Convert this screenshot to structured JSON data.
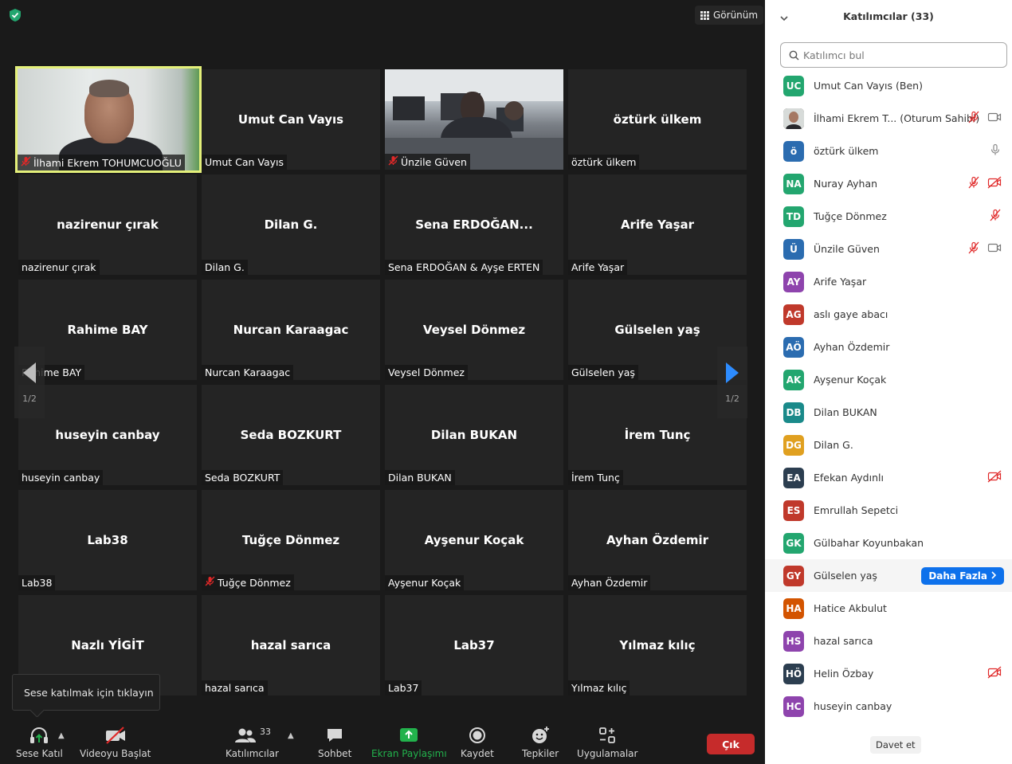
{
  "toolbar_top": {
    "view_label": "Görünüm"
  },
  "tiles": [
    {
      "center": "",
      "label": "İlhami Ekrem TOHUMCUOĞLU",
      "muted": true,
      "video": "ilhami",
      "active": true
    },
    {
      "center": "Umut Can Vayıs",
      "label": "Umut Can Vayıs",
      "muted": false
    },
    {
      "center": "",
      "label": "Ünzile Güven",
      "muted": true,
      "video": "classroom"
    },
    {
      "center": "öztürk ülkem",
      "label": "öztürk ülkem",
      "muted": false
    },
    {
      "center": "nazirenur çırak",
      "label": "nazirenur çırak",
      "muted": false
    },
    {
      "center": "Dilan G.",
      "label": "Dilan G.",
      "muted": false
    },
    {
      "center": "Sena ERDOĞAN...",
      "label": "Sena ERDOĞAN & Ayşe ERTEN",
      "muted": false
    },
    {
      "center": "Arife Yaşar",
      "label": "Arife Yaşar",
      "muted": false
    },
    {
      "center": "Rahime BAY",
      "label": "Rahime BAY",
      "muted": false
    },
    {
      "center": "Nurcan Karaagac",
      "label": "Nurcan Karaagac",
      "muted": false
    },
    {
      "center": "Veysel Dönmez",
      "label": "Veysel Dönmez",
      "muted": false
    },
    {
      "center": "Gülselen yaş",
      "label": "Gülselen yaş",
      "muted": false
    },
    {
      "center": "huseyin canbay",
      "label": "huseyin canbay",
      "muted": false
    },
    {
      "center": "Seda BOZKURT",
      "label": "Seda BOZKURT",
      "muted": false
    },
    {
      "center": "Dilan BUKAN",
      "label": "Dilan BUKAN",
      "muted": false
    },
    {
      "center": "İrem Tunç",
      "label": "İrem Tunç",
      "muted": false
    },
    {
      "center": "Lab38",
      "label": "Lab38",
      "muted": false
    },
    {
      "center": "Tuğçe Dönmez",
      "label": "Tuğçe Dönmez",
      "muted": true
    },
    {
      "center": "Ayşenur Koçak",
      "label": "Ayşenur Koçak",
      "muted": false
    },
    {
      "center": "Ayhan Özdemir",
      "label": "Ayhan Özdemir",
      "muted": false
    },
    {
      "center": "Nazlı YİGİT",
      "label": "",
      "muted": false
    },
    {
      "center": "hazal sarıca",
      "label": "hazal sarıca",
      "muted": false
    },
    {
      "center": "Lab37",
      "label": "Lab37",
      "muted": false
    },
    {
      "center": "Yılmaz kılıç",
      "label": "Yılmaz kılıç",
      "muted": false
    }
  ],
  "pager": {
    "left": "1/2",
    "right": "1/2"
  },
  "tooltip": "Sese katılmak için tıklayın",
  "toolbar": {
    "join_audio": "Sese Katıl",
    "start_video": "Videoyu Başlat",
    "participants": "Katılımcılar",
    "participants_count": "33",
    "chat": "Sohbet",
    "share": "Ekran Paylaşımı",
    "record": "Kaydet",
    "reactions": "Tepkiler",
    "apps": "Uygulamalar",
    "leave": "Çık"
  },
  "panel": {
    "title": "Katılımcılar (33)",
    "search_placeholder": "Katılımcı bul",
    "more_label": "Daha Fazla",
    "invite_label": "Davet et",
    "participants": [
      {
        "initials": "UC",
        "color": "#23a66f",
        "name": "Umut Can Vayıs (Ben)",
        "icons": []
      },
      {
        "initials": "",
        "color": "#5a4a42",
        "name": "İlhami Ekrem T...  (Oturum Sahibi)",
        "icons": [
          "mic-muted",
          "video"
        ],
        "photo": true
      },
      {
        "initials": "ö",
        "color": "#2b6cb0",
        "name": "öztürk ülkem",
        "icons": [
          "mic-gray"
        ]
      },
      {
        "initials": "NA",
        "color": "#23a66f",
        "name": "Nuray Ayhan",
        "icons": [
          "mic-muted",
          "video-off"
        ]
      },
      {
        "initials": "TD",
        "color": "#23a66f",
        "name": "Tuğçe Dönmez",
        "icons": [
          "mic-muted"
        ]
      },
      {
        "initials": "Ü",
        "color": "#2b6cb0",
        "name": "Ünzile Güven",
        "icons": [
          "mic-muted",
          "video"
        ]
      },
      {
        "initials": "AY",
        "color": "#8e44ad",
        "name": "Arife Yaşar",
        "icons": []
      },
      {
        "initials": "AG",
        "color": "#c0392b",
        "name": "aslı gaye abacı",
        "icons": []
      },
      {
        "initials": "AÖ",
        "color": "#2b6cb0",
        "name": "Ayhan Özdemir",
        "icons": []
      },
      {
        "initials": "AK",
        "color": "#23a66f",
        "name": "Ayşenur Koçak",
        "icons": []
      },
      {
        "initials": "DB",
        "color": "#1a8a8a",
        "name": "Dilan BUKAN",
        "icons": []
      },
      {
        "initials": "DG",
        "color": "#e0a020",
        "name": "Dilan G.",
        "icons": []
      },
      {
        "initials": "EA",
        "color": "#2c3e50",
        "name": "Efekan Aydınlı",
        "icons": [
          "video-off"
        ]
      },
      {
        "initials": "ES",
        "color": "#c0392b",
        "name": "Emrullah Sepetci",
        "icons": []
      },
      {
        "initials": "GK",
        "color": "#23a66f",
        "name": "Gülbahar Koyunbakan",
        "icons": []
      },
      {
        "initials": "GY",
        "color": "#c0392b",
        "name": "Gülselen yaş",
        "icons": [],
        "hover": true
      },
      {
        "initials": "HA",
        "color": "#d35400",
        "name": "Hatice Akbulut",
        "icons": []
      },
      {
        "initials": "HS",
        "color": "#8e44ad",
        "name": "hazal sarıca",
        "icons": []
      },
      {
        "initials": "HÖ",
        "color": "#2c3e50",
        "name": "Helin Özbay",
        "icons": [
          "video-off"
        ]
      },
      {
        "initials": "HC",
        "color": "#8e44ad",
        "name": "huseyin canbay",
        "icons": []
      }
    ]
  },
  "colors": {
    "accent_blue": "#0e71eb",
    "share_green": "#22b24c",
    "leave_red": "#c62b2b",
    "mute_red": "#e02828",
    "active_speaker": "#e4f07a"
  }
}
